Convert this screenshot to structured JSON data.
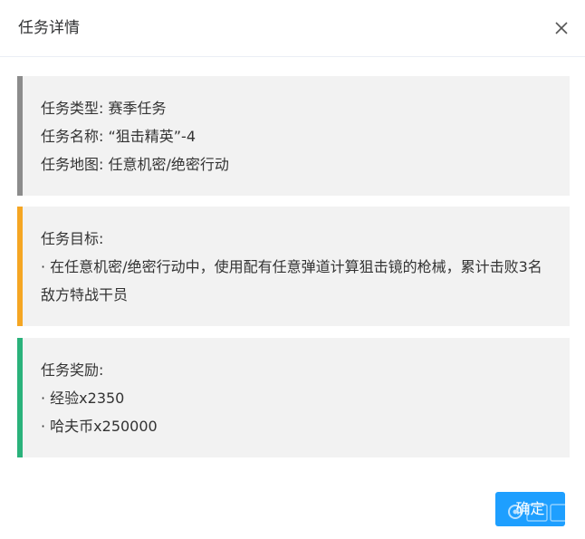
{
  "dialog": {
    "title": "任务详情",
    "close_icon": "close-icon"
  },
  "info": {
    "type_line": "任务类型: 赛季任务",
    "name_line": "任务名称: “狙击精英”-4",
    "map_line": "任务地图: 任意机密/绝密行动"
  },
  "goal": {
    "heading": "任务目标:",
    "text": "· 在任意机密/绝密行动中，使用配有任意弹道计算狙击镜的枪械，累计击败3名敌方特战干员"
  },
  "reward": {
    "heading": "任务奖励:",
    "items": [
      "· 经验x2350",
      "· 哈夫币x250000"
    ]
  },
  "footer": {
    "confirm_label": "确定"
  },
  "colors": {
    "info_bar": "#8c8c8c",
    "goal_bar": "#f5a623",
    "reward_bar": "#2ab27b",
    "confirm_bg": "#1e9fff",
    "card_bg": "#f2f2f2"
  }
}
